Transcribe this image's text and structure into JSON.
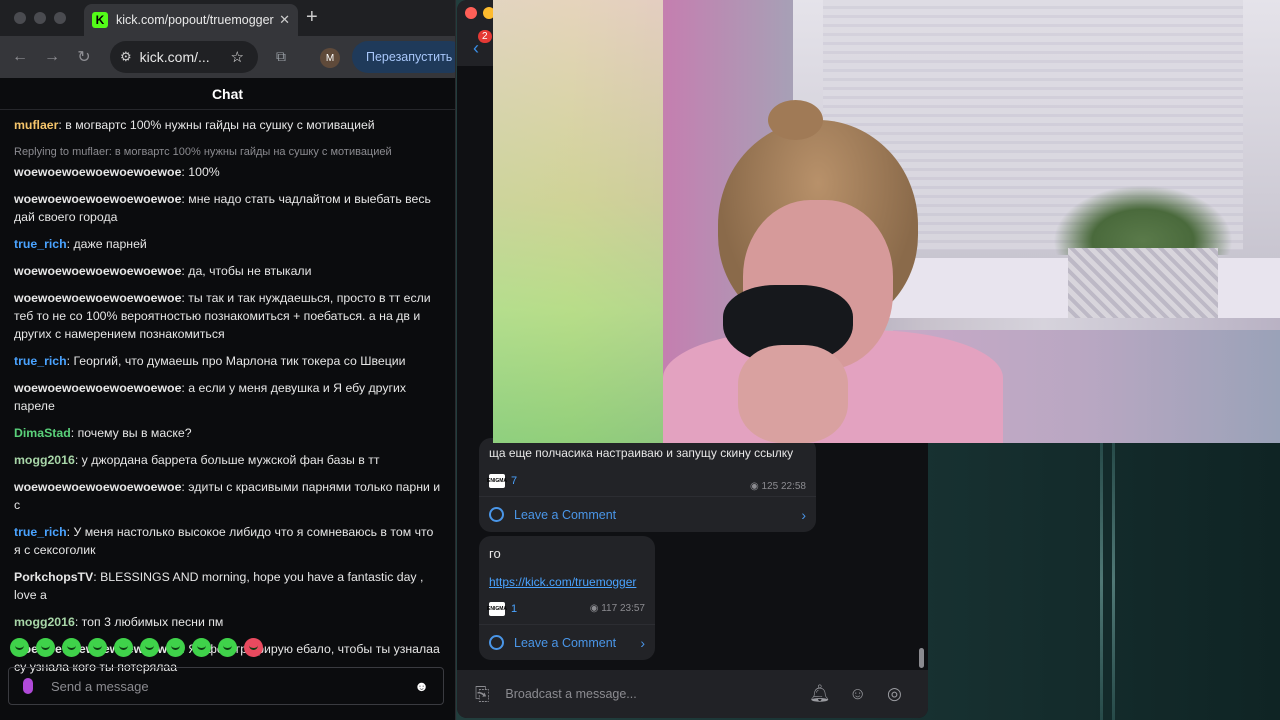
{
  "browser": {
    "tab_title": "kick.com/popout/truemogger",
    "tab_close": "✕",
    "new_tab": "+",
    "url": "kick.com/...",
    "relaunch_label": "Перезапустить",
    "profile_initial": "M",
    "favicon_letter": "K"
  },
  "chat": {
    "header": "Chat",
    "messages": [
      {
        "user": "muflaer",
        "color": "#f5c56b",
        "text": "в могвартс 100% нужны гайды на сушку с мотивацией"
      },
      {
        "reply": "Replying to muflaer: в могвартс 100% нужны гайды на сушку с мотивацией",
        "user": "woewoewoewoewoewoewoe",
        "color": "#e6e6e6",
        "text": "100%"
      },
      {
        "user": "woewoewoewoewoewoewoe",
        "color": "#e6e6e6",
        "text": "мне надо стать чадлайтом и выебать весь дай своего города"
      },
      {
        "user": "true_rich",
        "color": "#4aa3ff",
        "text": "даже парней"
      },
      {
        "user": "woewoewoewoewoewoewoe",
        "color": "#e6e6e6",
        "text": "да, чтобы не втыкали"
      },
      {
        "user": "woewoewoewoewoewoewoe",
        "color": "#e6e6e6",
        "text": "ты так и так нуждаешься, просто в тт если теб то не со 100% вероятностью познакомиться + поебаться. а на дв и других с намерением познакомиться"
      },
      {
        "user": "true_rich",
        "color": "#4aa3ff",
        "text": "Георгий, что думаешь про Марлона тик токера со Швеции"
      },
      {
        "user": "woewoewoewoewoewoewoe",
        "color": "#e6e6e6",
        "text": "а если у меня девушка и Я ебу других пареле"
      },
      {
        "user": "DimaStad",
        "color": "#5ad17a",
        "text": "почему вы в маске?"
      },
      {
        "user": "mogg2016",
        "color": "#a8d6a8",
        "text": "у джордана баррета больше мужской фан базы в тт"
      },
      {
        "user": "woewoewoewoewoewoewoe",
        "color": "#e6e6e6",
        "text": "эдиты с красивыми парнями только парни и с"
      },
      {
        "user": "true_rich",
        "color": "#4aa3ff",
        "text": "У меня настолько высокое либидо что я сомневаюсь в том что я с сексоголик"
      },
      {
        "user": "PorkchopsTV",
        "color": "#e6e6e6",
        "text": "BLESSINGS AND morning, hope you have a fantastic day , love a"
      },
      {
        "user": "mogg2016",
        "color": "#a8d6a8",
        "text": "топ 3 любимых песни пм"
      },
      {
        "user": "woewoewoewoewoewoewoe",
        "color": "#e6e6e6",
        "text": "Я сфотографирую ебало, чтобы ты узналаа су узнала кого ты потерялаа"
      }
    ],
    "send_placeholder": "Send a message"
  },
  "telegram": {
    "unread_badge": "2",
    "posts": [
      {
        "text": "ща еще полчасика настраиваю и запущу скину ссылку",
        "reaction_count": "7",
        "views": "125",
        "time": "22:58",
        "comments_label": "Leave a Comment"
      },
      {
        "text": "го",
        "link": "https://kick.com/truemogger",
        "reaction_count": "1",
        "views": "117",
        "time": "23:57",
        "comments_label": "Leave a Comment"
      }
    ],
    "reaction_logo": "ENIGMA",
    "input_placeholder": "Broadcast a message..."
  },
  "colors": {
    "kick_green": "#53fc18",
    "tg_link": "#4aa3ff",
    "tg_bg": "#0f1013"
  }
}
